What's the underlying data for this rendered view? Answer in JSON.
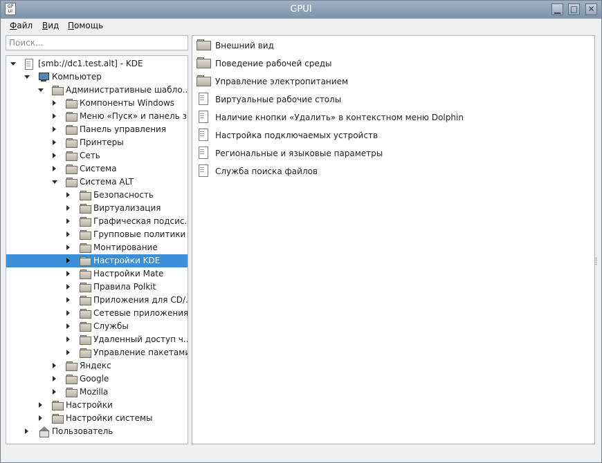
{
  "window": {
    "title": "GPUI",
    "app_icon_text": [
      "GP",
      "UI"
    ],
    "controls": {
      "minimize": "▁",
      "maximize": "□",
      "close": "✕"
    }
  },
  "menubar": [
    {
      "first": "Ф",
      "rest": "айл"
    },
    {
      "first": "В",
      "rest": "ид"
    },
    {
      "first": "П",
      "rest": "омощь"
    }
  ],
  "search": {
    "placeholder": "Поиск...",
    "value": ""
  },
  "tree": [
    {
      "label": "[smb://dc1.test.alt] - KDE",
      "level": 0,
      "expander": "down",
      "icon": "document"
    },
    {
      "label": "Компьютер",
      "level": 1,
      "expander": "down",
      "icon": "computer"
    },
    {
      "label": "Административные шабло...",
      "level": 2,
      "expander": "down",
      "icon": "folder"
    },
    {
      "label": "Компоненты Windows",
      "level": 3,
      "expander": "right",
      "icon": "folder"
    },
    {
      "label": "Меню «Пуск» и панель з...",
      "level": 3,
      "expander": "right",
      "icon": "folder"
    },
    {
      "label": "Панель управления",
      "level": 3,
      "expander": "right",
      "icon": "folder"
    },
    {
      "label": "Принтеры",
      "level": 3,
      "expander": "right",
      "icon": "folder"
    },
    {
      "label": "Сеть",
      "level": 3,
      "expander": "right",
      "icon": "folder"
    },
    {
      "label": "Система",
      "level": 3,
      "expander": "right",
      "icon": "folder"
    },
    {
      "label": "Система ALT",
      "level": 3,
      "expander": "down",
      "icon": "folder"
    },
    {
      "label": "Безопасность",
      "level": 4,
      "expander": "right",
      "icon": "folder"
    },
    {
      "label": "Виртуализация",
      "level": 4,
      "expander": "right",
      "icon": "folder"
    },
    {
      "label": "Графическая подсис...",
      "level": 4,
      "expander": "right",
      "icon": "folder"
    },
    {
      "label": "Групповые политики",
      "level": 4,
      "expander": "right",
      "icon": "folder"
    },
    {
      "label": "Монтирование",
      "level": 4,
      "expander": "right",
      "icon": "folder"
    },
    {
      "label": "Настройки KDE",
      "level": 4,
      "expander": "right",
      "icon": "folder",
      "selected": true
    },
    {
      "label": "Настройки Mate",
      "level": 4,
      "expander": "right",
      "icon": "folder"
    },
    {
      "label": "Правила Polkit",
      "level": 4,
      "expander": "right",
      "icon": "folder"
    },
    {
      "label": "Приложения для CD/...",
      "level": 4,
      "expander": "right",
      "icon": "folder"
    },
    {
      "label": "Сетевые приложения",
      "level": 4,
      "expander": "right",
      "icon": "folder"
    },
    {
      "label": "Службы",
      "level": 4,
      "expander": "right",
      "icon": "folder"
    },
    {
      "label": "Удаленный доступ ч...",
      "level": 4,
      "expander": "right",
      "icon": "folder"
    },
    {
      "label": "Управление пакетами",
      "level": 4,
      "expander": "right",
      "icon": "folder"
    },
    {
      "label": "Яндекс",
      "level": 3,
      "expander": "right",
      "icon": "folder"
    },
    {
      "label": "Google",
      "level": 3,
      "expander": "right",
      "icon": "folder"
    },
    {
      "label": "Mozilla",
      "level": 3,
      "expander": "right",
      "icon": "folder"
    },
    {
      "label": "Настройки",
      "level": 2,
      "expander": "right",
      "icon": "folder"
    },
    {
      "label": "Настройки системы",
      "level": 2,
      "expander": "right",
      "icon": "folder"
    },
    {
      "label": "Пользователь",
      "level": 1,
      "expander": "right",
      "icon": "home"
    }
  ],
  "content": [
    {
      "label": "Внешний вид",
      "icon": "folder"
    },
    {
      "label": "Поведение рабочей среды",
      "icon": "folder"
    },
    {
      "label": "Управление электропитанием",
      "icon": "folder"
    },
    {
      "label": "Виртуальные рабочие столы",
      "icon": "document"
    },
    {
      "label": "Наличие кнопки «Удалить» в контекстном меню Dolphin",
      "icon": "document"
    },
    {
      "label": "Настройка подключаемых устройств",
      "icon": "document"
    },
    {
      "label": "Региональные и языковые параметры",
      "icon": "document"
    },
    {
      "label": "Служба поиска файлов",
      "icon": "document"
    }
  ]
}
